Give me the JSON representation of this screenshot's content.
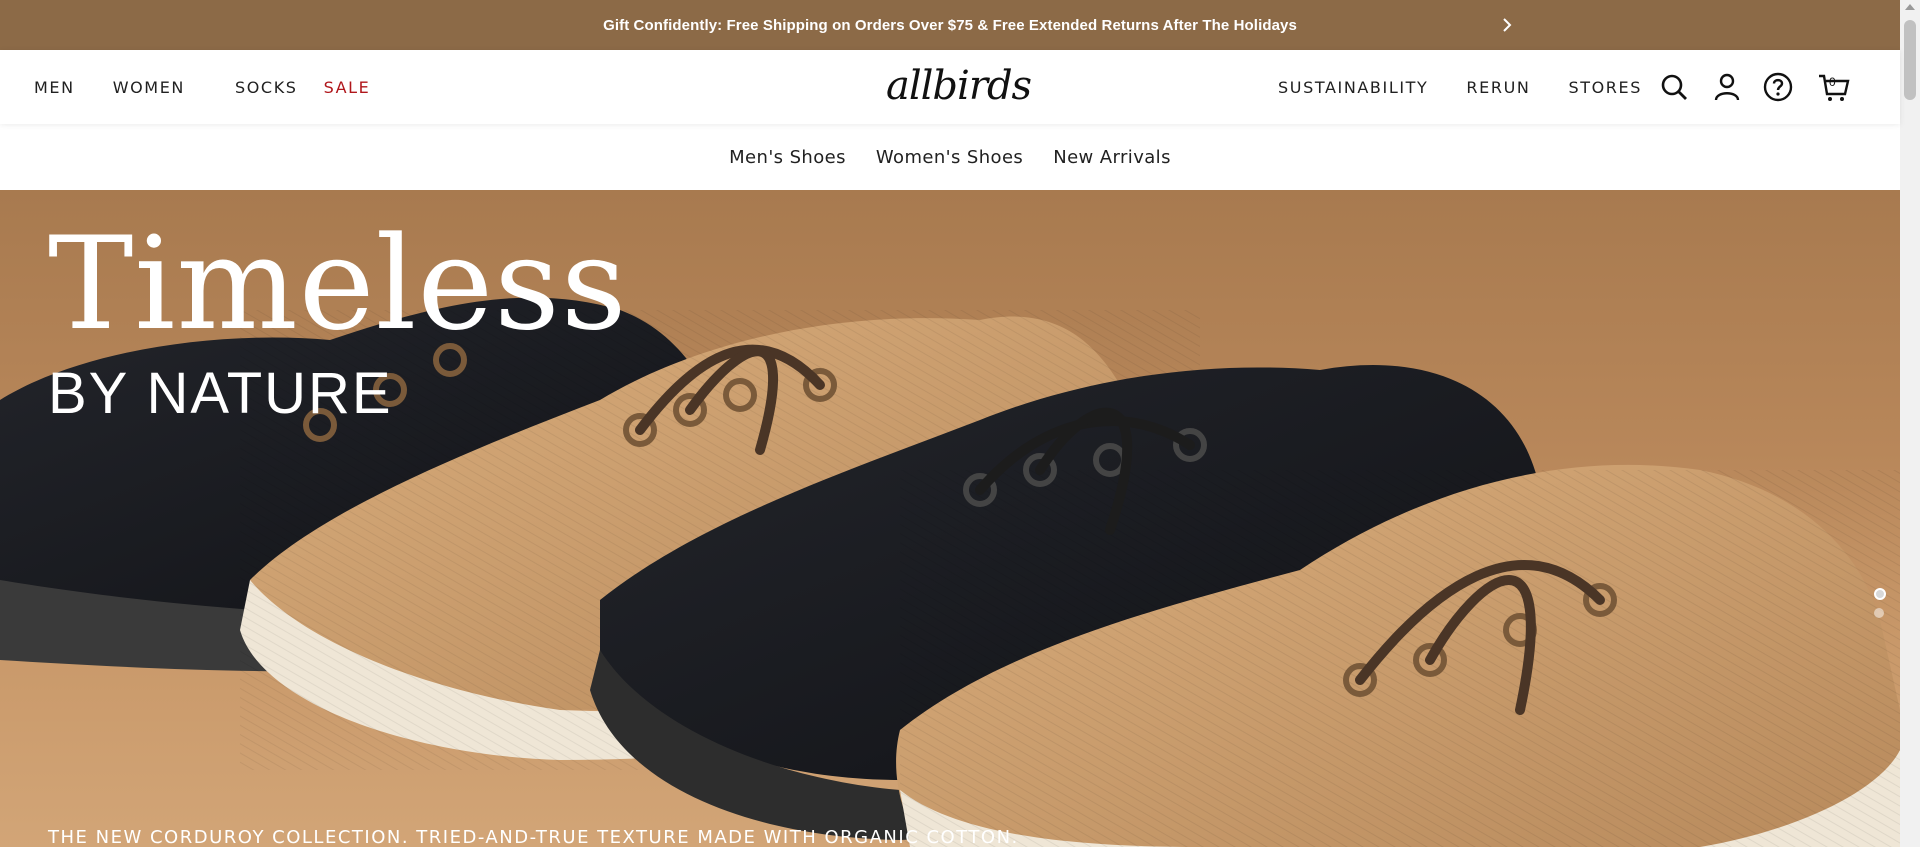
{
  "banner": {
    "text": "Gift Confidently: Free Shipping on Orders Over $75 & Free Extended Returns After The Holidays"
  },
  "nav": {
    "left": [
      "MEN",
      "WOMEN",
      "SOCKS",
      "SALE"
    ],
    "logo": "allbirds",
    "right": [
      "SUSTAINABILITY",
      "RERUN",
      "STORES"
    ],
    "cart_count": "0"
  },
  "subnav": [
    "Men's Shoes",
    "Women's Shoes",
    "New Arrivals"
  ],
  "hero": {
    "title": "Timeless",
    "subtitle": "BY NATURE",
    "caption": "THE NEW CORDUROY COLLECTION. TRIED-AND-TRUE TEXTURE MADE WITH ORGANIC COTTON."
  },
  "colors": {
    "banner": "#8c6a47",
    "sale": "#b0161b",
    "hero_bg": "#b8875a"
  }
}
